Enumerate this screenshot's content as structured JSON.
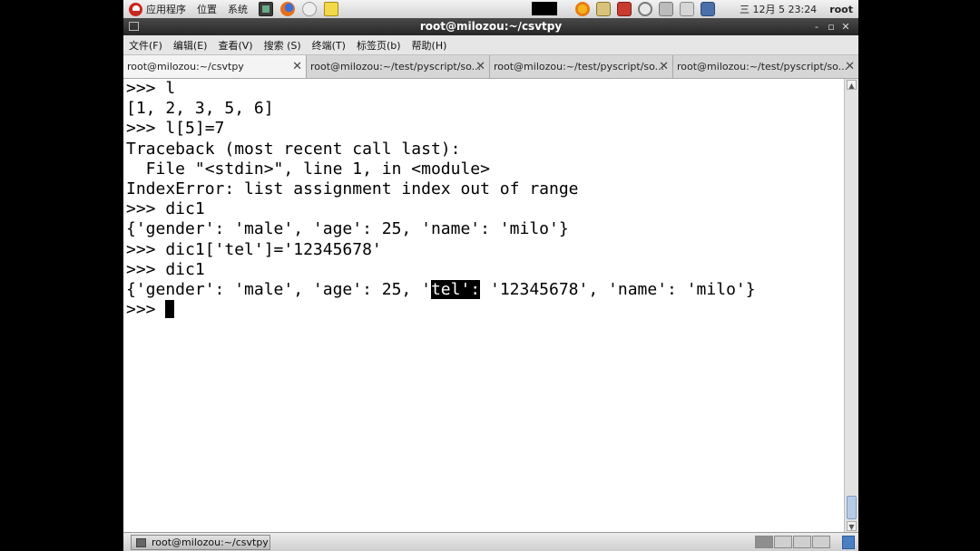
{
  "top_panel": {
    "menus": [
      "应用程序",
      "位置",
      "系统"
    ],
    "launchers": [
      "terminal-icon",
      "firefox-icon",
      "mail-icon",
      "note-icon"
    ],
    "tray_icons": [
      "weather-icon",
      "update-icon",
      "bookmark-icon",
      "power-icon",
      "network-icon",
      "volume-icon",
      "display-icon"
    ],
    "clock": "三 12月  5 23:24",
    "user": "root"
  },
  "window": {
    "title": "root@milozou:~/csvtpy",
    "controls": [
      "-",
      "▫",
      "✕"
    ]
  },
  "menu_bar": {
    "items": [
      "文件(F)",
      "编辑(E)",
      "查看(V)",
      "搜索 (S)",
      "终端(T)",
      "标签页(b)",
      "帮助(H)"
    ]
  },
  "tabs": [
    {
      "label": "root@milozou:~/csvtpy",
      "active": true
    },
    {
      "label": "root@milozou:~/test/pyscript/so...",
      "active": false
    },
    {
      "label": "root@milozou:~/test/pyscript/so...",
      "active": false
    },
    {
      "label": "root@milozou:~/test/pyscript/so...",
      "active": false
    }
  ],
  "terminal": {
    "lines": [
      ">>> l",
      "[1, 2, 3, 5, 6]",
      ">>> l[5]=7",
      "Traceback (most recent call last):",
      "  File \"<stdin>\", line 1, in <module>",
      "IndexError: list assignment index out of range",
      ">>> dic1",
      "{'gender': 'male', 'age': 25, 'name': 'milo'}",
      ">>> dic1['tel']='12345678'",
      ">>> dic1"
    ],
    "selection_line": {
      "before": "{'gender': 'male', 'age': 25, '",
      "selected": "tel':",
      "after": " '12345678', 'name': 'milo'}"
    },
    "prompt": ">>> "
  },
  "bottom_panel": {
    "task_label": "root@milozou:~/csvtpy"
  }
}
